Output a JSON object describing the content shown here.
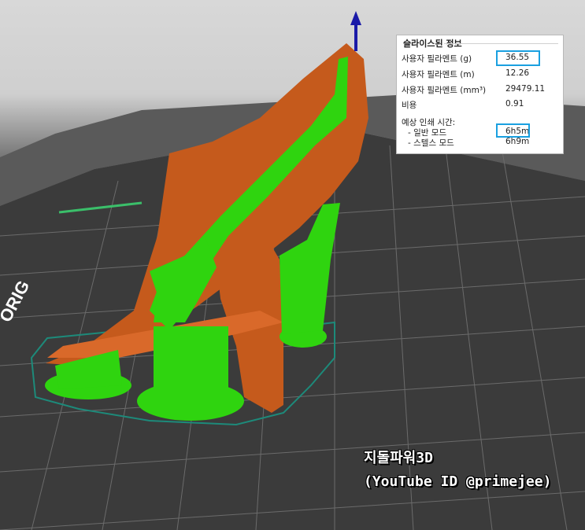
{
  "panel": {
    "title": "슬라이스된 정보",
    "rows": [
      {
        "label": "사용자 필라멘트 (g)",
        "value": "36.55"
      },
      {
        "label": "사용자 필라멘트 (m)",
        "value": "12.26"
      },
      {
        "label": "사용자 필라멘트 (mm³)",
        "value": "29479.11"
      },
      {
        "label": "비용",
        "value": "0.91"
      }
    ],
    "time_header": "예상 인쇄 시간:",
    "normal_mode": {
      "label": "- 일반 모드",
      "value": "6h5m"
    },
    "stealth_mode": {
      "label": "- 스텔스 모드",
      "value": "6h9m"
    }
  },
  "bed_text": "ORIG",
  "watermark": {
    "line1": "지돌파워3D",
    "line2": "(YouTube ID @primejee)"
  },
  "colors": {
    "support": "#2fd40f",
    "model": "#c55a1c",
    "highlight": "#1aa0e0",
    "axis": "#1a1aa8"
  }
}
